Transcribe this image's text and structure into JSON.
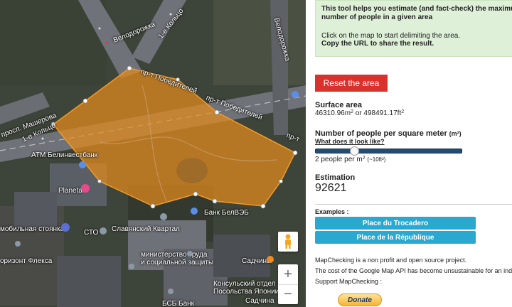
{
  "map": {
    "labels": {
      "velorozhka_a": "Велодорожка",
      "koltso_top": "1-е Кольцо",
      "velorozhka_b": "Велодорожка",
      "pr_pobediteley_1": "пр-т Победителей",
      "pr_pobediteley_2": "пр-т Победителей",
      "pr_pobediteley_3": "пр-т",
      "prosp_masherova": "просп. Машерова",
      "koltso_left": "1-е Кольцо",
      "atm": "ATM Белинвестбанк",
      "planeta": "Planeta",
      "parking": "мобильная стоянка",
      "sto": "СТО",
      "slavyansky": "Славянский Квартал",
      "bank_belveb": "Банк БелВЭБ",
      "ministry_1": "министерство труда",
      "ministry_2": "и социальной защиты",
      "sadchina_1": "Садчина",
      "fleksa": "оризонт Флекса",
      "consulate_1": "Консульский отдел",
      "consulate_2": "Посольства Японии",
      "sadchina_2": "Садчина",
      "bsb": "БСБ Банк"
    },
    "zoom_in": "+",
    "zoom_out": "−"
  },
  "panel": {
    "intro_bold": "This tool helps you estimate (and fact-check) the maximum number of people in a given area",
    "intro_line1": "Click on the map to start delimiting the area.",
    "intro_line2": "Copy the URL to share the result.",
    "reset_label": "Reset the area",
    "surface_title": "Surface area",
    "surface_m2": "46310.96m",
    "surface_sep": " or ",
    "surface_ft2": "498491.17ft",
    "density_title": "Number of people per square meter",
    "density_unit": "(m²)",
    "look_link": "What does it look like?",
    "density_value": 0.25,
    "density_text": "2 people per m",
    "density_approx": "(~10ft²)",
    "estimation_title": "Estimation",
    "estimation_value": "92621",
    "examples_title": "Examples :",
    "example_1": "Place du Trocadero",
    "example_2": "Place de la République",
    "footer_1": "MapChecking is a non profit and open source project.",
    "footer_2": "The cost of the Google Map API has become unsustainable for an individual",
    "footer_3": "Support MapChecking :",
    "donate": "Donate"
  },
  "colors": {
    "polygon_fill": "#e58a1c",
    "reset_red": "#d9312b",
    "info_green": "#dff0d8",
    "example_blue": "#2aa8d0"
  }
}
